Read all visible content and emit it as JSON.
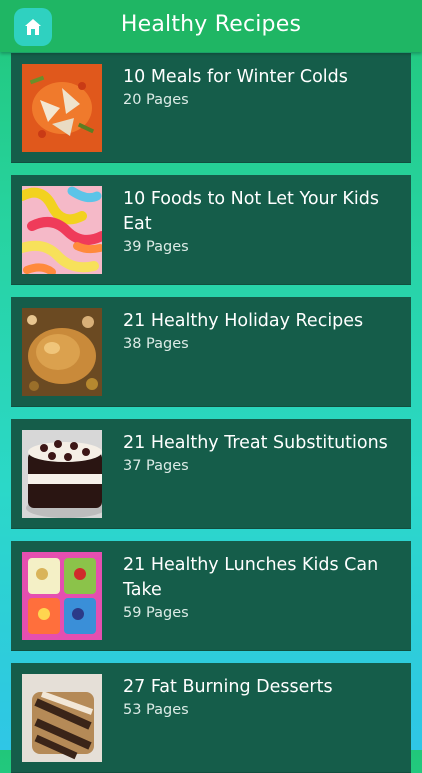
{
  "header": {
    "title": "Healthy Recipes",
    "home_icon": "home-icon"
  },
  "colors": {
    "header_bg": "#1fb664",
    "card_bg": "#155d4a",
    "home_button_bg": "#2fd1c0",
    "gradient_top": "#21c77a",
    "gradient_bottom": "#2fc6e6"
  },
  "recipes": [
    {
      "title": "10 Meals for Winter Colds",
      "pages": "20 Pages"
    },
    {
      "title": "10 Foods to Not Let Your Kids Eat",
      "pages": "39 Pages"
    },
    {
      "title": "21 Healthy Holiday Recipes",
      "pages": "38 Pages"
    },
    {
      "title": "21 Healthy Treat Substitutions",
      "pages": "37 Pages"
    },
    {
      "title": "21 Healthy Lunches Kids Can Take",
      "pages": "59 Pages"
    },
    {
      "title": "27 Fat Burning Desserts",
      "pages": "53 Pages"
    }
  ]
}
